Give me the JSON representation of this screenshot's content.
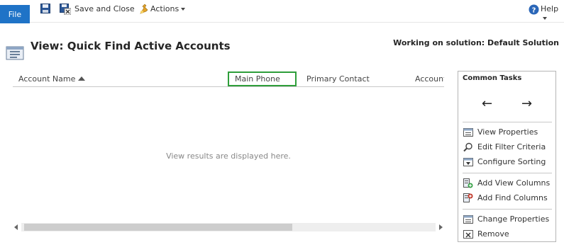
{
  "ribbon": {
    "file_label": "File",
    "save_close_label": "Save and Close",
    "actions_label": "Actions",
    "help_label": "Help",
    "accent_color": "#1f73c7"
  },
  "header": {
    "title": "View: Quick Find Active Accounts",
    "solution_text": "Working on solution: Default Solution"
  },
  "grid": {
    "columns": [
      "Account Name",
      "Main Phone",
      "Primary Contact",
      "Account"
    ],
    "sorted_column": "Account Name",
    "selected_column": "Main Phone",
    "selected_border_color": "#2e9e3a",
    "empty_message": "View results are displayed here."
  },
  "tasks": {
    "title": "Common Tasks",
    "items": [
      {
        "label": "View Properties",
        "icon": "view-properties-icon"
      },
      {
        "label": "Edit Filter Criteria",
        "icon": "magnifier-icon"
      },
      {
        "label": "Configure Sorting",
        "icon": "sort-icon"
      },
      {
        "label": "Add View Columns",
        "icon": "add-view-columns-icon"
      },
      {
        "label": "Add Find Columns",
        "icon": "add-find-columns-icon"
      },
      {
        "label": "Change Properties",
        "icon": "change-properties-icon"
      },
      {
        "label": "Remove",
        "icon": "remove-icon"
      }
    ]
  }
}
